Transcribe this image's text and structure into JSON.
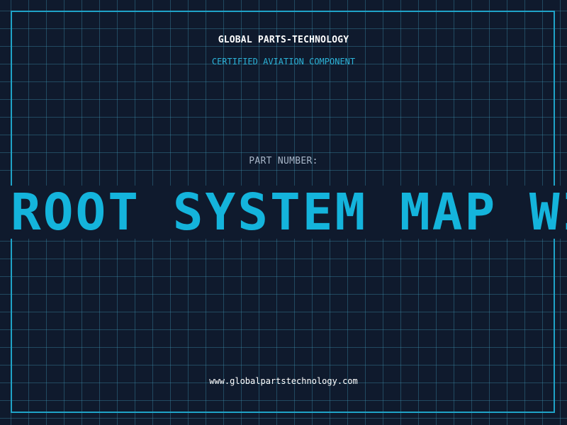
{
  "header": {
    "company": "GLOBAL PARTS-TECHNOLOGY",
    "tagline": "CERTIFIED AVIATION COMPONENT"
  },
  "part": {
    "label": "PART NUMBER:",
    "value": "ROOT SYSTEM MAP WI"
  },
  "footer": {
    "website": "www.globalpartstechnology.com"
  },
  "colors": {
    "background": "#0f1a2d",
    "grid": "#2f6f86",
    "accent": "#14b4dc",
    "frame": "#1fa3c7"
  }
}
